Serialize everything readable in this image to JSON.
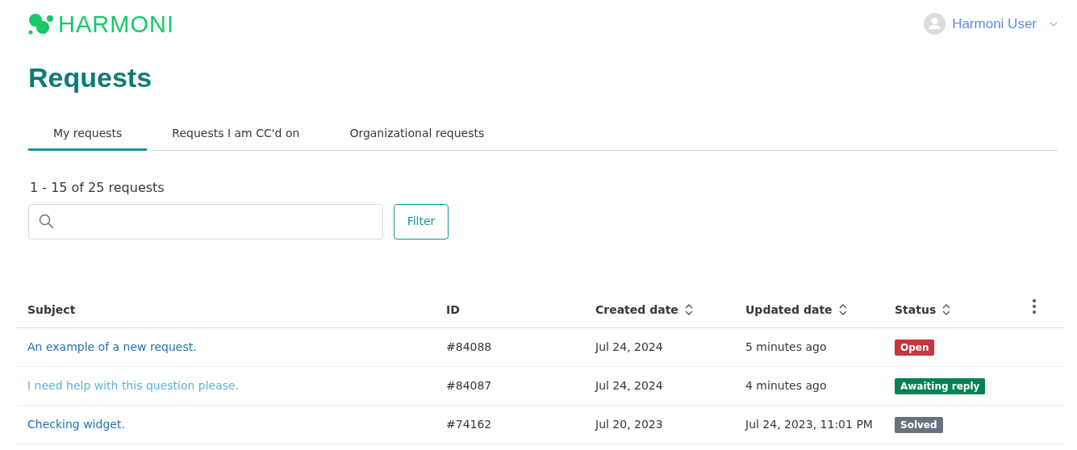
{
  "logo": {
    "text": "HARMONI"
  },
  "user": {
    "name": "Harmoni User"
  },
  "page_title": "Requests",
  "tabs": [
    {
      "label": "My requests",
      "selected": true
    },
    {
      "label": "Requests I am CC'd on",
      "selected": false
    },
    {
      "label": "Organizational requests",
      "selected": false
    }
  ],
  "count": "1 - 15 of 25 requests",
  "filter_button": "Filter",
  "table": {
    "columns": [
      {
        "label": "Subject",
        "sortable": false
      },
      {
        "label": "ID",
        "sortable": false
      },
      {
        "label": "Created date",
        "sortable": true
      },
      {
        "label": "Updated date",
        "sortable": true
      },
      {
        "label": "Status",
        "sortable": true
      }
    ],
    "rows": [
      {
        "subject": "An example of a new request.",
        "highlighted": false,
        "id": "#84088",
        "created": "Jul 24, 2024",
        "updated": "5 minutes ago",
        "status": "Open",
        "color": "#cc3340"
      },
      {
        "subject": "I need help with this question please.",
        "highlighted": true,
        "id": "#84087",
        "created": "Jul 24, 2024",
        "updated": "4 minutes ago",
        "status": "Awaiting reply",
        "color": "#038153"
      },
      {
        "subject": "Checking widget.",
        "highlighted": false,
        "id": "#74162",
        "created": "Jul 20, 2023",
        "updated": "Jul 24, 2023, 11:01 PM",
        "status": "Solved",
        "color": "#68737d"
      }
    ]
  }
}
